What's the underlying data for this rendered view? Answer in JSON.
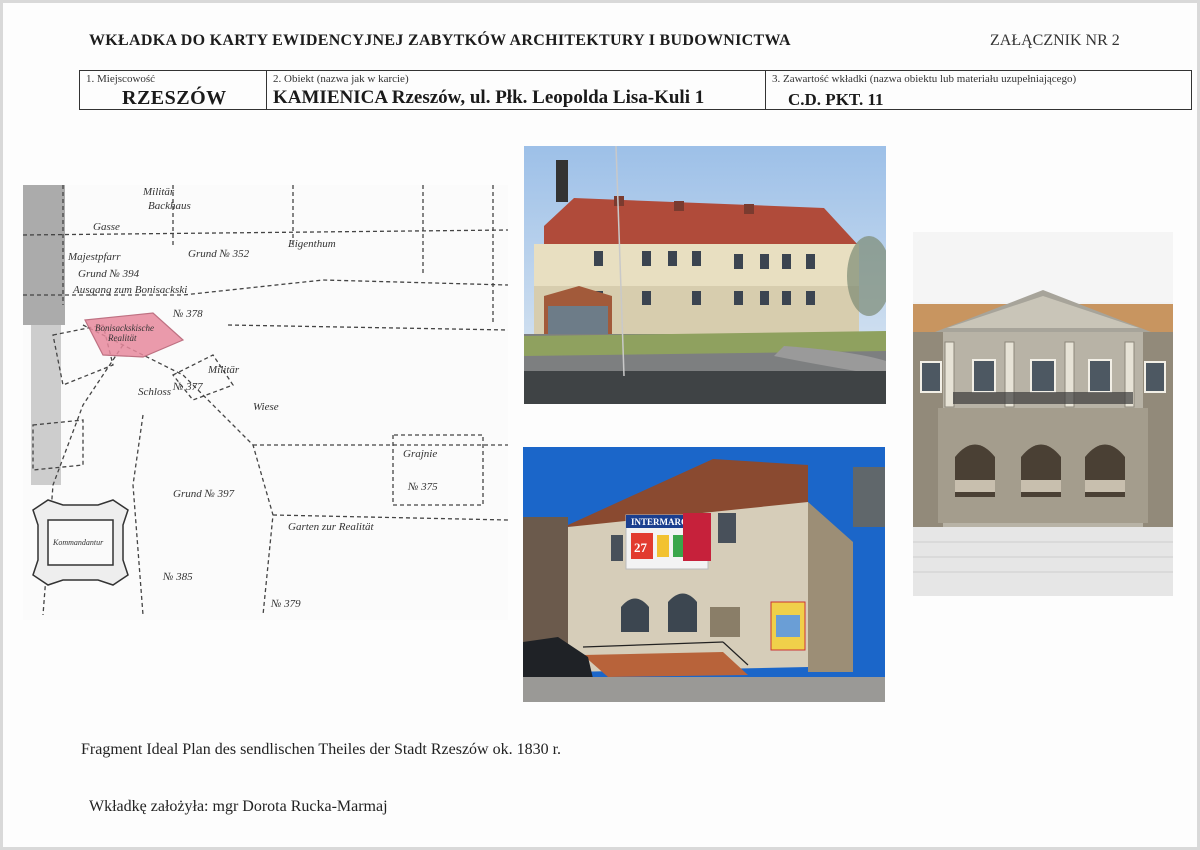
{
  "header": {
    "title": "WKŁADKA DO KARTY EWIDENCYJNEJ ZABYTKÓW ARCHITEKTURY I BUDOWNICTWA",
    "annex": "ZAŁĄCZNIK NR 2"
  },
  "info": {
    "locality_label": "1. Miejscowość",
    "locality_value": "RZESZÓW",
    "object_label": "2. Obiekt (nazwa jak w karcie)",
    "object_value": "KAMIENICA  Rzeszów, ul. Płk. Leopolda Lisa-Kuli 1",
    "contents_label": "3. Zawartość wkładki (nazwa obiektu lub materiału uzupełniającego)",
    "contents_value": "C.D. PKT. 11"
  },
  "map": {
    "labels": [
      "Militär",
      "Backhaus",
      "Gasse",
      "Majestpfarr",
      "Grund № 394",
      "Grund № 352",
      "Ausgang zum Bonisackski",
      "Eigenthum",
      "Bonisackskische Realität",
      "№ 378",
      "№ 377",
      "Schloss",
      "Militär",
      "Wiese",
      "Garten",
      "Grajnie",
      "№ 375",
      "Garten zur Realität",
      "Grund № 397",
      "№ 385",
      "№ 379",
      "Kommandantur"
    ],
    "highlight_color": "#e88a9e"
  },
  "photos": {
    "photo1": {
      "alt": "Widok kamienicy od ulicy"
    },
    "photo2": {
      "alt": "Narożny budynek z reklamą",
      "sign_text": "INTERMARCHE",
      "sign_number": "27"
    },
    "photo3": {
      "alt": "Portyk z kolumnami"
    }
  },
  "caption": "Fragment Ideal Plan des sendlischen Theiles der Stadt Rzeszów ok. 1830 r.",
  "author": "Wkładkę założyła: mgr Dorota Rucka-Marmaj"
}
